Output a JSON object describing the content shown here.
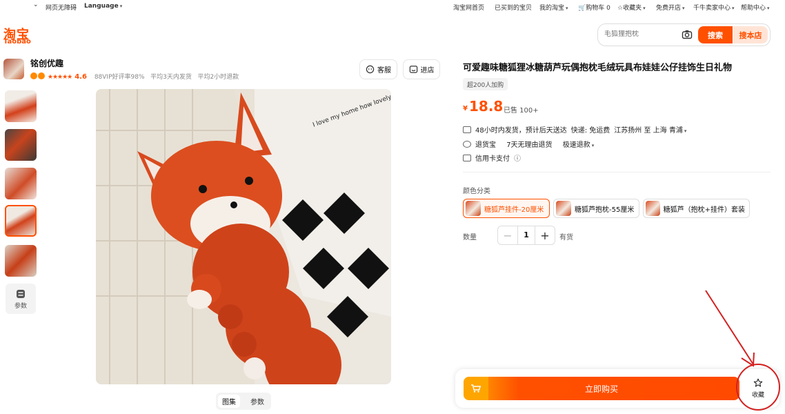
{
  "topbar": {
    "accessibility": "网页无障碍",
    "language": "Language",
    "home": "淘宝网首页",
    "bought": "已买到的宝贝",
    "my_taobao": "我的淘宝",
    "cart": "购物车 0",
    "favorites": "收藏夹",
    "open_store": "免费开店",
    "seller_center": "千牛卖家中心",
    "help": "帮助中心"
  },
  "logo": {
    "cn": "淘宝",
    "en": "Taobao"
  },
  "search": {
    "placeholder": "毛狐狸抱枕",
    "search_label": "搜索",
    "store_label": "搜本店"
  },
  "shop": {
    "name": "铭创优趣",
    "rating": "4.6",
    "meta_88vip": "88VIP好评率98%",
    "meta_ship": "平均3天内发货",
    "meta_reply": "平均2小时退款",
    "service_label": "客服",
    "enter_label": "进店"
  },
  "gallery": {
    "param_label": "参数",
    "tab_gallery": "图集",
    "tab_params": "参数"
  },
  "image_text": "I love my home how lovely it is happy ever after happy as I am",
  "product": {
    "title": "可爱趣味糖狐狸冰糖葫芦玩偶抱枕毛绒玩具布娃娃公仔挂饰生日礼物",
    "tag": "超200人加购",
    "currency": "¥",
    "price": "18.8",
    "sold": "已售 100+"
  },
  "shipping": {
    "line1_a": "48小时内发货，预计后天送达",
    "line1_b": "快递: 免运费",
    "line1_c": "江苏扬州 至 上海 青浦",
    "line2_a": "退货宝",
    "line2_b": "7天无理由退货",
    "line2_c": "极速退款",
    "line3": "信用卡支付"
  },
  "options": {
    "label": "颜色分类",
    "items": [
      "糖狐芦挂件-20厘米",
      "糖狐芦抱枕-55厘米",
      "糖狐芦（抱枕+挂件）套装"
    ]
  },
  "quantity": {
    "label": "数量",
    "value": "1",
    "stock": "有货"
  },
  "buybar": {
    "buy_label": "立即购买",
    "fav_label": "收藏"
  },
  "colors": {
    "accent": "#ff5000",
    "annotation": "#d42020"
  }
}
